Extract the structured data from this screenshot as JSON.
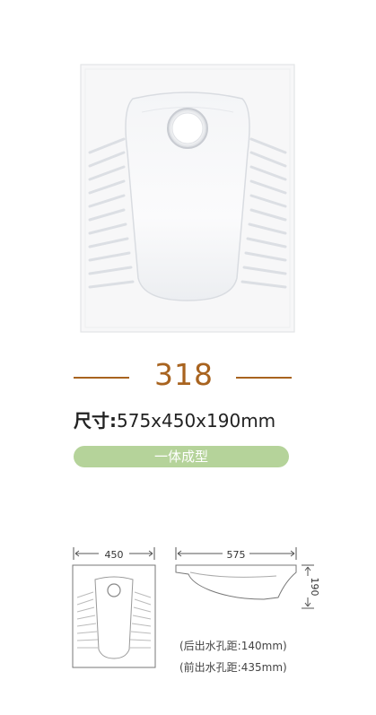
{
  "model": "318",
  "dims": {
    "label": "尺寸",
    "separator": ":",
    "value": "575x450x190mm"
  },
  "feature": "一体成型",
  "drawing": {
    "top_width": "450",
    "side_width": "575",
    "side_height": "190"
  },
  "distances": {
    "rear": "(后出水孔距:140mm)",
    "front": "(前出水孔距:435mm)"
  },
  "colors": {
    "accent": "#a8631f",
    "pill": "#b5d39a"
  }
}
